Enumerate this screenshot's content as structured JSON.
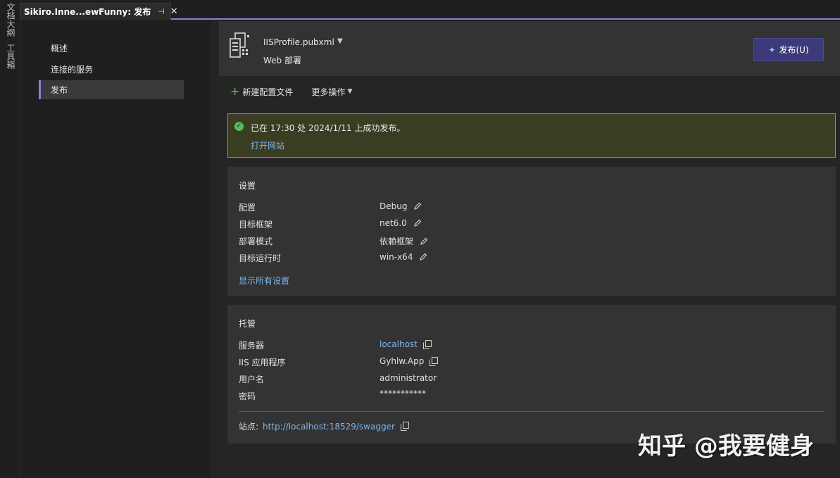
{
  "rail": {
    "items": [
      "文档大纲",
      "工具箱"
    ]
  },
  "tab": {
    "title": "Sikiro.Inne...ewFunny: 发布",
    "pin": "⊣",
    "close": "✕"
  },
  "nav": {
    "items": [
      "概述",
      "连接的服务",
      "发布"
    ],
    "active_index": 2
  },
  "header": {
    "profile_name": "IISProfile.pubxml",
    "profile_sub": "Web 部署",
    "publish_button": "发布(U)"
  },
  "toolbar": {
    "new_profile": "新建配置文件",
    "more_actions": "更多操作"
  },
  "banner": {
    "message": "已在 17:30 处 2024/1/11 上成功发布。",
    "open_site": "打开网站"
  },
  "settings": {
    "title": "设置",
    "rows": [
      {
        "key": "配置",
        "value": "Debug"
      },
      {
        "key": "目标框架",
        "value": "net6.0"
      },
      {
        "key": "部署模式",
        "value": "依赖框架"
      },
      {
        "key": "目标运行时",
        "value": "win-x64"
      }
    ],
    "show_all": "显示所有设置"
  },
  "hosting": {
    "title": "托管",
    "rows": [
      {
        "key": "服务器",
        "value": "localhost"
      },
      {
        "key": "IIS 应用程序",
        "value": "Gyhlw.App"
      },
      {
        "key": "用户名",
        "value": "administrator"
      },
      {
        "key": "密码",
        "value": "***********"
      }
    ],
    "site_label": "站点:",
    "site_url": "http://localhost:18529/swagger"
  },
  "watermark": "知乎 @我要健身",
  "colors": {
    "accent": "#8b7fd6",
    "link": "#7fb4e8",
    "success_border": "#6aa845",
    "publish_bg": "#3d3a7a"
  }
}
